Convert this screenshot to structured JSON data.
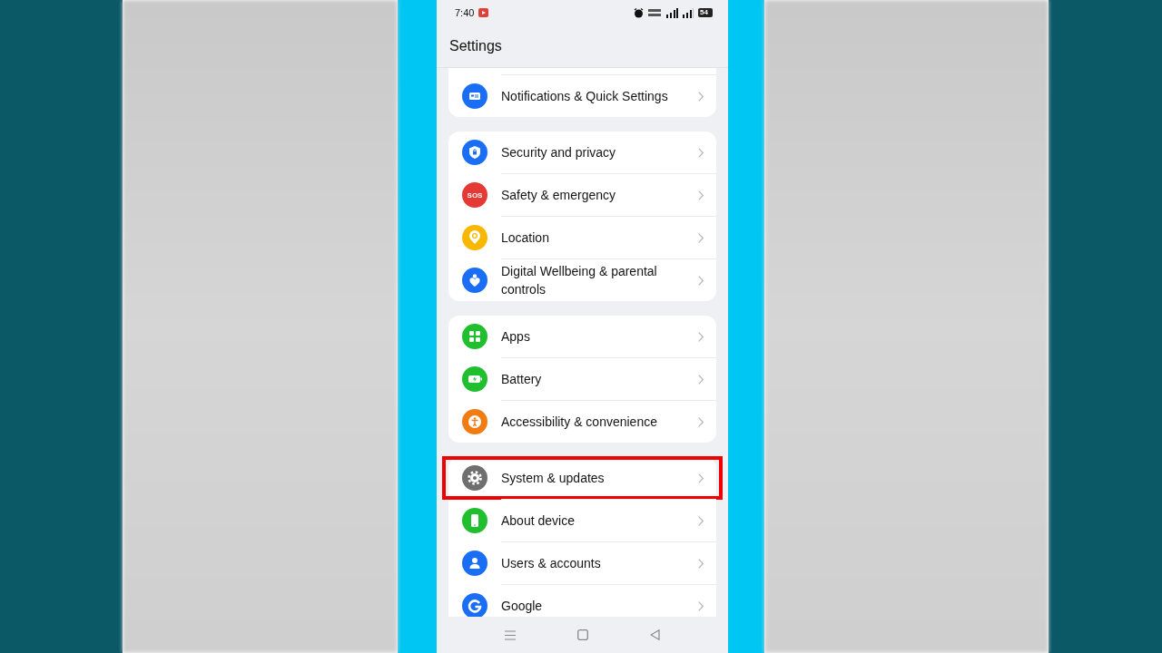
{
  "status_bar": {
    "time": "7:40",
    "battery": "54"
  },
  "header": {
    "title": "Settings"
  },
  "groups": [
    {
      "items": [
        {
          "label": "Notifications & Quick Settings",
          "kind": "notifications",
          "color": "#1a6ef5",
          "highlighted": false
        }
      ]
    },
    {
      "items": [
        {
          "label": "Security and privacy",
          "kind": "shield",
          "color": "#1a6ef5",
          "highlighted": false
        },
        {
          "label": "Safety & emergency",
          "kind": "sos",
          "icon_text": "SOS",
          "color": "#e53935",
          "highlighted": false
        },
        {
          "label": "Location",
          "kind": "pin",
          "color": "#f9b800",
          "highlighted": false
        },
        {
          "label": "Digital Wellbeing & parental controls",
          "kind": "heart",
          "color": "#1a6ef5",
          "highlighted": false
        }
      ]
    },
    {
      "items": [
        {
          "label": "Apps",
          "kind": "grid",
          "color": "#1fbf2e",
          "highlighted": false
        },
        {
          "label": "Battery",
          "kind": "battery",
          "color": "#1fbf2e",
          "highlighted": false
        },
        {
          "label": "Accessibility & convenience",
          "kind": "person",
          "color": "#f07c12",
          "highlighted": false
        }
      ]
    },
    {
      "items": [
        {
          "label": "System & updates",
          "kind": "gear",
          "color": "#6f6f6f",
          "highlighted": true
        },
        {
          "label": "About device",
          "kind": "phone",
          "color": "#1fbf2e",
          "highlighted": false
        },
        {
          "label": "Users & accounts",
          "kind": "user",
          "color": "#1a6ef5",
          "highlighted": false
        },
        {
          "label": "Google",
          "kind": "g",
          "color": "#1a6ef5",
          "highlighted": false
        }
      ]
    }
  ]
}
